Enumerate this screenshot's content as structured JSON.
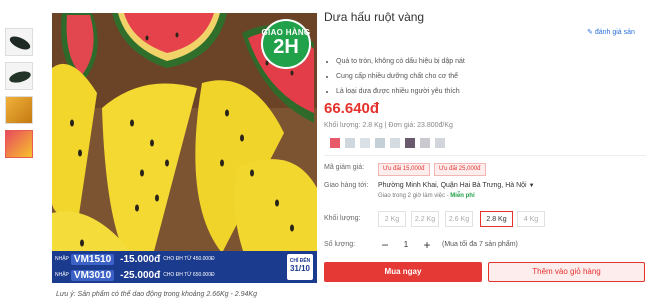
{
  "gallery": {
    "badge_line1": "GIAO HÀNG",
    "badge_line2": "2H",
    "promo": [
      {
        "label": "NHẬP",
        "code": "VM1510",
        "amount": "-15.000đ",
        "condition": "CHO ĐH TỪ 450.000Đ"
      },
      {
        "label": "NHẬP",
        "code": "VM3010",
        "amount": "-25.000đ",
        "condition": "CHO ĐH TỪ 650.000Đ"
      }
    ],
    "promo_date_label": "CHỈ ĐẾN",
    "promo_date": "31/10",
    "caption": "Lưu ý: Sản phẩm có thể dao động trong khoảng 2.66Kg - 2.94Kg"
  },
  "product": {
    "title": "Dưa hấu ruột vàng",
    "rating_link": "đánh giá sản",
    "bullets": [
      "Quả to tròn, không có dấu hiệu bị dập nát",
      "Cung cấp nhiều dưỡng chất cho cơ thể",
      "Là loại dưa được nhiều người yêu thích"
    ],
    "price": "66.640đ",
    "weight_info": "Khối lượng: 2.8  Kg |  Đơn giá: 23.800đ/Kg",
    "swatch_colors": [
      "#e85a6a",
      "#cfd8de",
      "#d9e1e6",
      "#c5cfd6",
      "#d4dce2",
      "#6a5a6e",
      "#c9c9cf",
      "#d2d6dc"
    ]
  },
  "coupon": {
    "label": "Mã giảm giá:",
    "items": [
      "Ưu đãi 15,000đ",
      "Ưu đãi 25,000đ"
    ]
  },
  "delivery": {
    "label": "Giao hàng tới:",
    "address": "Phường Minh Khai, Quận Hai Bà Trưng, Hà Nội",
    "eta": "Giao trong 2 giờ làm việc - ",
    "fee": "Miễn phí"
  },
  "weight_options": {
    "label": "Khối lượng:",
    "options": [
      "2 Kg",
      "2.2 Kg",
      "2.6 Kg",
      "2.8 Kg",
      "4 Kg"
    ],
    "selected": "2.8 Kg"
  },
  "quantity": {
    "label": "Số lượng:",
    "minus": "−",
    "value": "1",
    "plus": "+",
    "note": "(Mua tối đa 7 sản phẩm)"
  },
  "actions": {
    "buy_now": "Mua ngay",
    "add_to_cart": "Thêm vào giỏ hàng"
  },
  "colors": {
    "accent": "#e5322d",
    "promo_blue": "#1b3b8f",
    "delivery_green": "#21a14a"
  }
}
